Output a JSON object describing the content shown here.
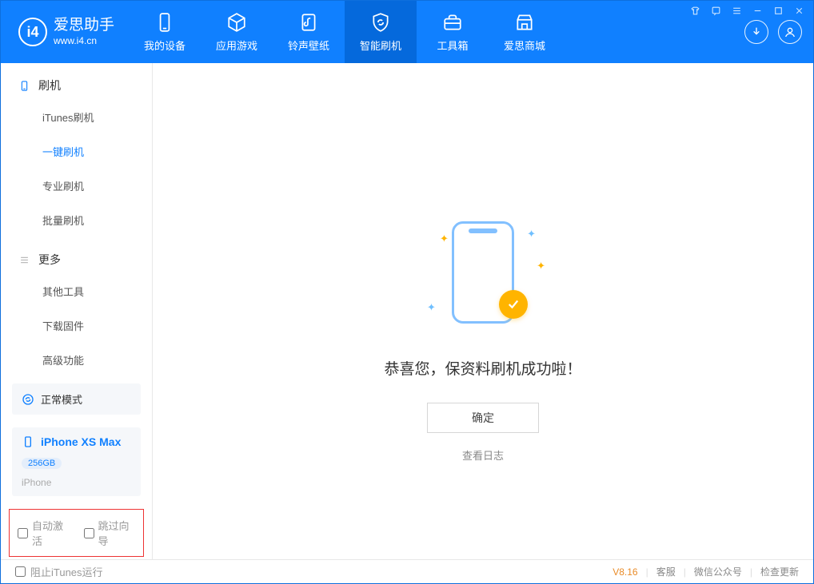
{
  "app": {
    "name": "爱思助手",
    "url": "www.i4.cn"
  },
  "nav": {
    "tabs": [
      {
        "label": "我的设备"
      },
      {
        "label": "应用游戏"
      },
      {
        "label": "铃声壁纸"
      },
      {
        "label": "智能刷机"
      },
      {
        "label": "工具箱"
      },
      {
        "label": "爱思商城"
      }
    ]
  },
  "sidebar": {
    "section_flash": "刷机",
    "items_flash": [
      "iTunes刷机",
      "一键刷机",
      "专业刷机",
      "批量刷机"
    ],
    "section_more": "更多",
    "items_more": [
      "其他工具",
      "下载固件",
      "高级功能"
    ],
    "mode_label": "正常模式",
    "device": {
      "name": "iPhone XS Max",
      "capacity": "256GB",
      "type": "iPhone"
    },
    "chk_auto_activate": "自动激活",
    "chk_skip_guide": "跳过向导"
  },
  "main": {
    "success_msg": "恭喜您，保资料刷机成功啦！",
    "ok_label": "确定",
    "view_log": "查看日志"
  },
  "footer": {
    "block_itunes": "阻止iTunes运行",
    "version": "V8.16",
    "links": [
      "客服",
      "微信公众号",
      "检查更新"
    ]
  },
  "colors": {
    "primary": "#1080ff",
    "accent": "#ffb400"
  }
}
